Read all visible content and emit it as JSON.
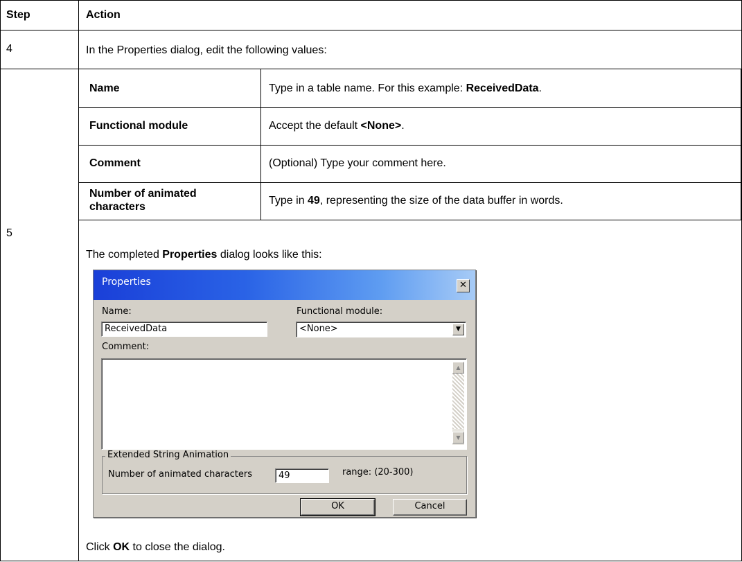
{
  "table": {
    "header": {
      "step": "Step",
      "action": "Action"
    },
    "row4": {
      "step": "4",
      "intro": "In the Properties dialog, edit the following values:",
      "items": [
        {
          "name": "Name",
          "desc_prefix": "Type in a table name. For this example: ",
          "desc_bold": "ReceivedData",
          "desc_suffix": "."
        },
        {
          "name": "Functional module",
          "desc_prefix": "Accept the default ",
          "desc_bold": "<None>",
          "desc_suffix": "."
        },
        {
          "name": "Comment",
          "desc_prefix": "(Optional) Type your comment here.",
          "desc_bold": "",
          "desc_suffix": ""
        },
        {
          "name_line1": "Number of animated",
          "name_line2": "characters",
          "desc_prefix": "Type in ",
          "desc_bold": "49",
          "desc_suffix": ", representing the size of the data buffer in words."
        }
      ]
    },
    "row5": {
      "step": "5",
      "intro_prefix": "The completed ",
      "intro_bold": "Properties",
      "intro_suffix": " dialog looks like this:",
      "outro_prefix": "Click ",
      "outro_bold": "OK",
      "outro_suffix": " to close the dialog."
    }
  },
  "dialog": {
    "title": "Properties",
    "close_glyph": "✕",
    "name_label": "Name:",
    "name_value": "ReceivedData",
    "module_label": "Functional module:",
    "module_value": "<None>",
    "dropdown_glyph": "▼",
    "comment_label": "Comment:",
    "comment_value": "",
    "scroll_up_glyph": "▲",
    "scroll_down_glyph": "▼",
    "group_label": "Extended String Animation",
    "animated_label": "Number of animated characters",
    "animated_value": "49",
    "range_label": "range: (20-300)",
    "ok_label": "OK",
    "cancel_label": "Cancel"
  }
}
